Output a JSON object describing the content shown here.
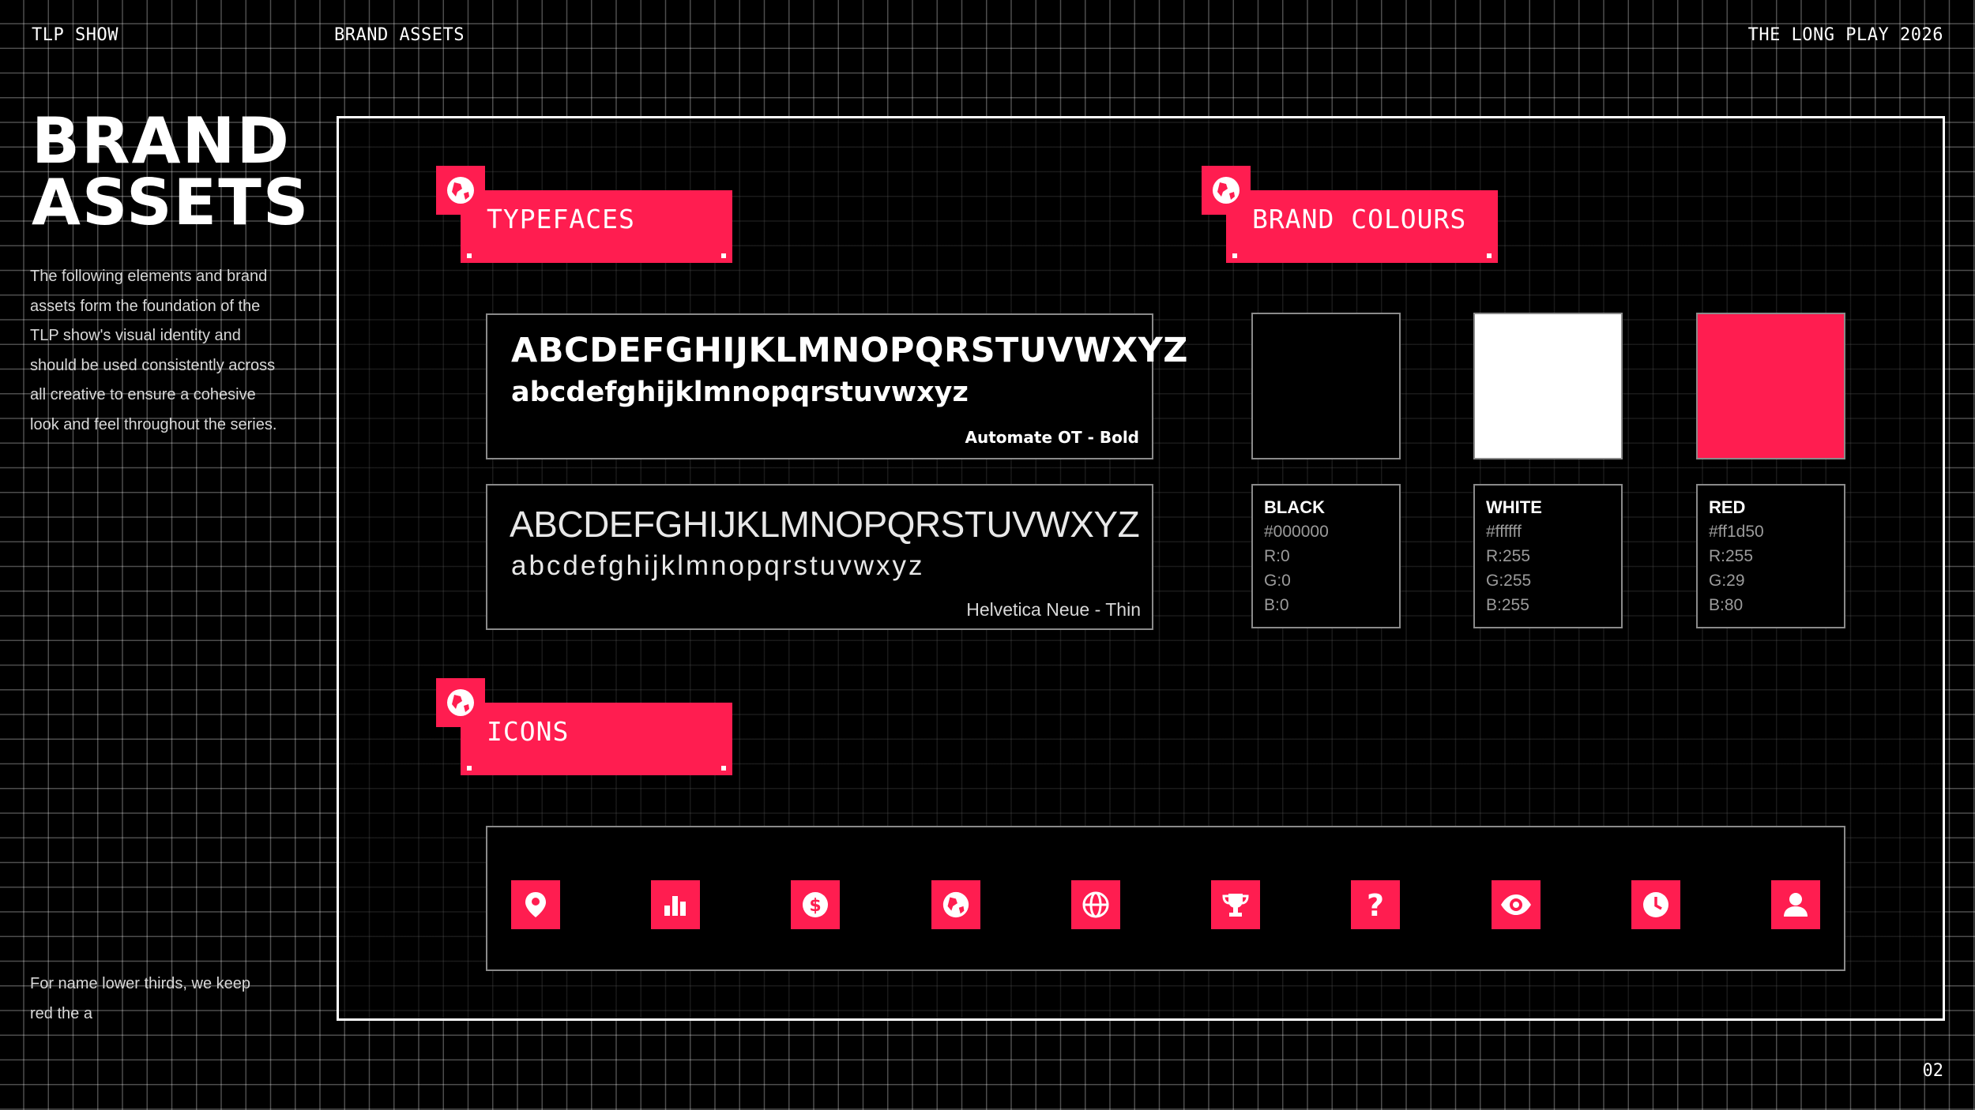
{
  "header": {
    "left": "TLP SHOW",
    "center": "BRAND ASSETS",
    "right": "THE LONG PLAY 2026"
  },
  "sidebar": {
    "title_line1": "BRAND",
    "title_line2": "ASSETS",
    "description": "The following elements and brand assets form the foundation of the TLP show's visual identity and should be used consistently across all creative to ensure a cohesive look and feel throughout the series.",
    "footer_note": "For name lower thirds, we keep red the a"
  },
  "sections": {
    "typefaces": "TYPEFACES",
    "brand_colours": "BRAND COLOURS",
    "icons": "ICONS"
  },
  "typefaces": [
    {
      "upper": "ABCDEFGHIJKLMNOPQRSTUVWXYZ",
      "lower": "abcdefghijklmnopqrstuvwxyz",
      "name": "Automate OT - Bold"
    },
    {
      "upper": "ABCDEFGHIJKLMNOPQRSTUVWXYZ",
      "lower": "abcdefghijklmnopqrstuvwxyz",
      "name": "Helvetica Neue - Thin"
    }
  ],
  "colours": [
    {
      "name": "BLACK",
      "hex": "#000000",
      "r": "R:0",
      "g": "G:0",
      "b": "B:0",
      "swatch": "#000000"
    },
    {
      "name": "WHITE",
      "hex": "#ffffff",
      "r": "R:255",
      "g": "G:255",
      "b": "B:255",
      "swatch": "#ffffff"
    },
    {
      "name": "RED",
      "hex": "#ff1d50",
      "r": "R:255",
      "g": "G:29",
      "b": "B:80",
      "swatch": "#ff1d50"
    }
  ],
  "icons": [
    "map-pin-icon",
    "bar-chart-icon",
    "dollar-icon",
    "globe-icon",
    "world-grid-icon",
    "trophy-icon",
    "question-icon",
    "eye-icon",
    "clock-icon",
    "user-icon"
  ],
  "page_number": "02",
  "accent_color": "#ff1d50"
}
